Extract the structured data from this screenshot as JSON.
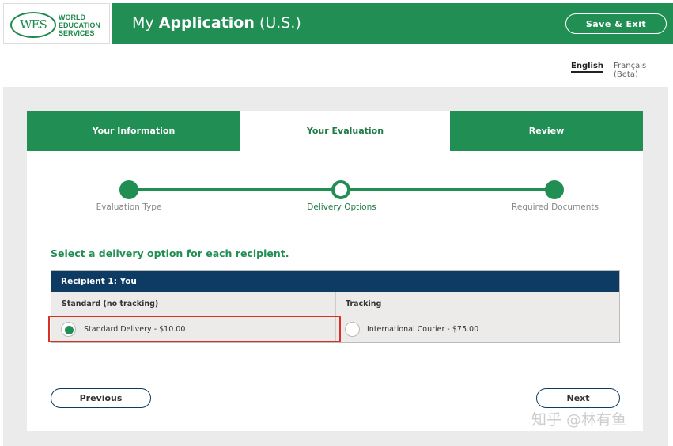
{
  "header": {
    "logo_letters": "WES",
    "logo_text_lines": [
      "WORLD",
      "EDUCATION",
      "SERVICES"
    ],
    "title_prefix": "My",
    "title_bold": "Application",
    "title_suffix": "(U.S.)",
    "save_exit_label": "Save & Exit"
  },
  "languages": {
    "english": "English",
    "french": "Français (Beta)"
  },
  "tabs": [
    {
      "label": "Your Information",
      "active": false
    },
    {
      "label": "Your Evaluation",
      "active": true
    },
    {
      "label": "Review",
      "active": false
    }
  ],
  "stepper": {
    "steps": [
      {
        "label": "Evaluation Type",
        "state": "complete"
      },
      {
        "label": "Delivery Options",
        "state": "current"
      },
      {
        "label": "Required Documents",
        "state": "upcoming"
      }
    ]
  },
  "section_title": "Select a delivery option for each recipient.",
  "recipient_table": {
    "header": "Recipient 1: You",
    "columns": [
      {
        "heading": "Standard (no tracking)",
        "option_label": "Standard Delivery - $10.00",
        "selected": true
      },
      {
        "heading": "Tracking",
        "option_label": "International Courier - $75.00",
        "selected": false
      }
    ]
  },
  "buttons": {
    "previous": "Previous",
    "next": "Next"
  },
  "watermark": "知乎 @林有鱼",
  "colors": {
    "brand_green": "#218f53",
    "navy": "#0d3b63",
    "highlight_red": "#d93025"
  }
}
